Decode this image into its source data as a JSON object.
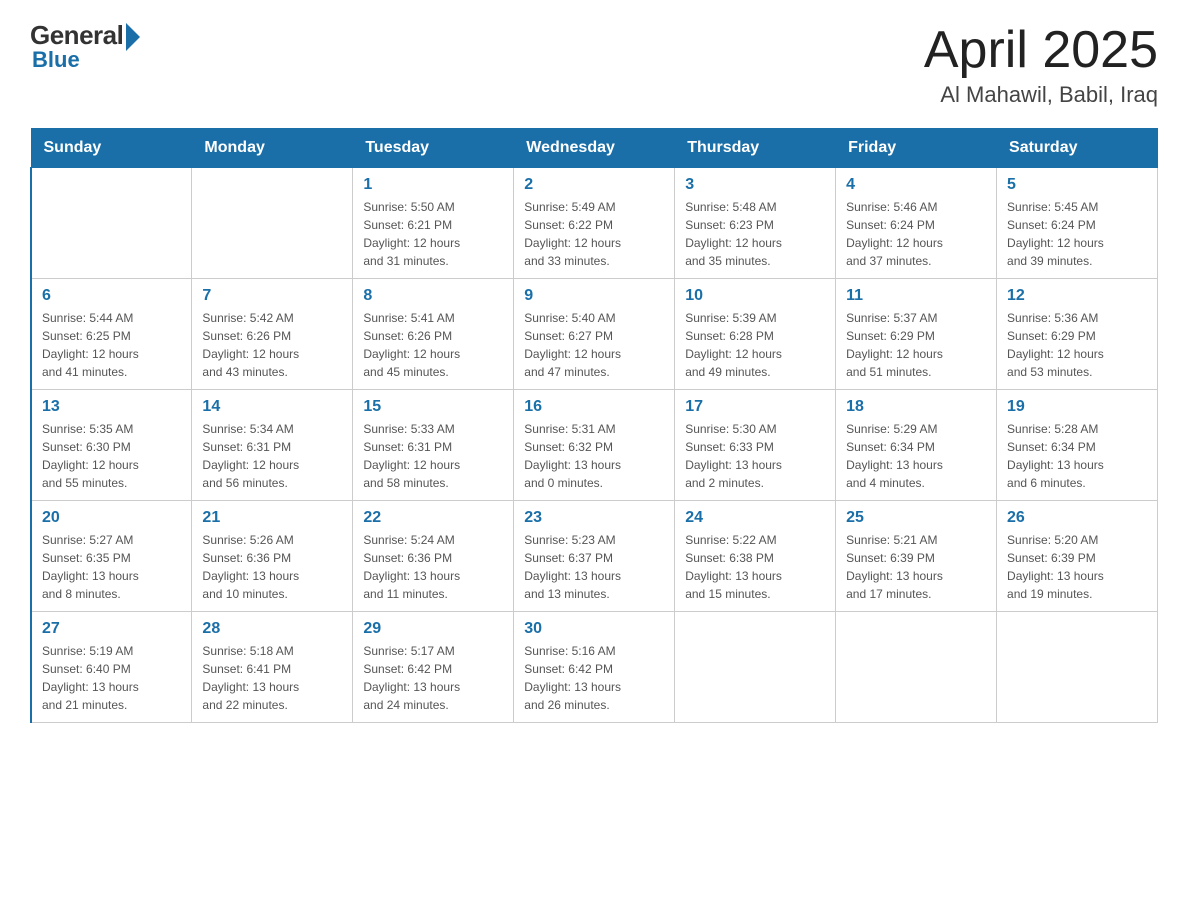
{
  "header": {
    "logo": {
      "general": "General",
      "blue": "Blue"
    },
    "title": "April 2025",
    "subtitle": "Al Mahawil, Babil, Iraq"
  },
  "days_of_week": [
    "Sunday",
    "Monday",
    "Tuesday",
    "Wednesday",
    "Thursday",
    "Friday",
    "Saturday"
  ],
  "weeks": [
    [
      {
        "day": "",
        "info": ""
      },
      {
        "day": "",
        "info": ""
      },
      {
        "day": "1",
        "info": "Sunrise: 5:50 AM\nSunset: 6:21 PM\nDaylight: 12 hours\nand 31 minutes."
      },
      {
        "day": "2",
        "info": "Sunrise: 5:49 AM\nSunset: 6:22 PM\nDaylight: 12 hours\nand 33 minutes."
      },
      {
        "day": "3",
        "info": "Sunrise: 5:48 AM\nSunset: 6:23 PM\nDaylight: 12 hours\nand 35 minutes."
      },
      {
        "day": "4",
        "info": "Sunrise: 5:46 AM\nSunset: 6:24 PM\nDaylight: 12 hours\nand 37 minutes."
      },
      {
        "day": "5",
        "info": "Sunrise: 5:45 AM\nSunset: 6:24 PM\nDaylight: 12 hours\nand 39 minutes."
      }
    ],
    [
      {
        "day": "6",
        "info": "Sunrise: 5:44 AM\nSunset: 6:25 PM\nDaylight: 12 hours\nand 41 minutes."
      },
      {
        "day": "7",
        "info": "Sunrise: 5:42 AM\nSunset: 6:26 PM\nDaylight: 12 hours\nand 43 minutes."
      },
      {
        "day": "8",
        "info": "Sunrise: 5:41 AM\nSunset: 6:26 PM\nDaylight: 12 hours\nand 45 minutes."
      },
      {
        "day": "9",
        "info": "Sunrise: 5:40 AM\nSunset: 6:27 PM\nDaylight: 12 hours\nand 47 minutes."
      },
      {
        "day": "10",
        "info": "Sunrise: 5:39 AM\nSunset: 6:28 PM\nDaylight: 12 hours\nand 49 minutes."
      },
      {
        "day": "11",
        "info": "Sunrise: 5:37 AM\nSunset: 6:29 PM\nDaylight: 12 hours\nand 51 minutes."
      },
      {
        "day": "12",
        "info": "Sunrise: 5:36 AM\nSunset: 6:29 PM\nDaylight: 12 hours\nand 53 minutes."
      }
    ],
    [
      {
        "day": "13",
        "info": "Sunrise: 5:35 AM\nSunset: 6:30 PM\nDaylight: 12 hours\nand 55 minutes."
      },
      {
        "day": "14",
        "info": "Sunrise: 5:34 AM\nSunset: 6:31 PM\nDaylight: 12 hours\nand 56 minutes."
      },
      {
        "day": "15",
        "info": "Sunrise: 5:33 AM\nSunset: 6:31 PM\nDaylight: 12 hours\nand 58 minutes."
      },
      {
        "day": "16",
        "info": "Sunrise: 5:31 AM\nSunset: 6:32 PM\nDaylight: 13 hours\nand 0 minutes."
      },
      {
        "day": "17",
        "info": "Sunrise: 5:30 AM\nSunset: 6:33 PM\nDaylight: 13 hours\nand 2 minutes."
      },
      {
        "day": "18",
        "info": "Sunrise: 5:29 AM\nSunset: 6:34 PM\nDaylight: 13 hours\nand 4 minutes."
      },
      {
        "day": "19",
        "info": "Sunrise: 5:28 AM\nSunset: 6:34 PM\nDaylight: 13 hours\nand 6 minutes."
      }
    ],
    [
      {
        "day": "20",
        "info": "Sunrise: 5:27 AM\nSunset: 6:35 PM\nDaylight: 13 hours\nand 8 minutes."
      },
      {
        "day": "21",
        "info": "Sunrise: 5:26 AM\nSunset: 6:36 PM\nDaylight: 13 hours\nand 10 minutes."
      },
      {
        "day": "22",
        "info": "Sunrise: 5:24 AM\nSunset: 6:36 PM\nDaylight: 13 hours\nand 11 minutes."
      },
      {
        "day": "23",
        "info": "Sunrise: 5:23 AM\nSunset: 6:37 PM\nDaylight: 13 hours\nand 13 minutes."
      },
      {
        "day": "24",
        "info": "Sunrise: 5:22 AM\nSunset: 6:38 PM\nDaylight: 13 hours\nand 15 minutes."
      },
      {
        "day": "25",
        "info": "Sunrise: 5:21 AM\nSunset: 6:39 PM\nDaylight: 13 hours\nand 17 minutes."
      },
      {
        "day": "26",
        "info": "Sunrise: 5:20 AM\nSunset: 6:39 PM\nDaylight: 13 hours\nand 19 minutes."
      }
    ],
    [
      {
        "day": "27",
        "info": "Sunrise: 5:19 AM\nSunset: 6:40 PM\nDaylight: 13 hours\nand 21 minutes."
      },
      {
        "day": "28",
        "info": "Sunrise: 5:18 AM\nSunset: 6:41 PM\nDaylight: 13 hours\nand 22 minutes."
      },
      {
        "day": "29",
        "info": "Sunrise: 5:17 AM\nSunset: 6:42 PM\nDaylight: 13 hours\nand 24 minutes."
      },
      {
        "day": "30",
        "info": "Sunrise: 5:16 AM\nSunset: 6:42 PM\nDaylight: 13 hours\nand 26 minutes."
      },
      {
        "day": "",
        "info": ""
      },
      {
        "day": "",
        "info": ""
      },
      {
        "day": "",
        "info": ""
      }
    ]
  ]
}
